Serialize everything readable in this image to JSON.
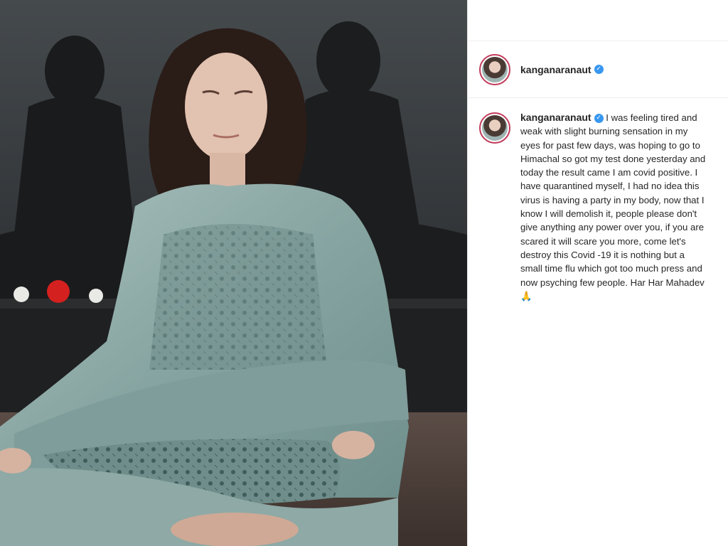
{
  "post": {
    "username": "kanganaranaut",
    "verified_icon": "verified-badge-icon",
    "caption": "I was feeling tired and weak with slight burning sensation in my eyes for past few days, was hoping to go to Himachal so got my test done yesterday and today the result came I am covid positive. I have quarantined myself, I had no idea this virus is having a party in my body, now that I know I will demolish it, people please don't give anything any power over you, if you are scared it will scare you more, come let's destroy this Covid -19 it is nothing but a small time flu which got too much press and now psyching few people. Har Har Mahadev 🙏"
  },
  "colors": {
    "avatar_ring": "#c13a5a",
    "verified": "#3897f0",
    "text": "#262626"
  }
}
